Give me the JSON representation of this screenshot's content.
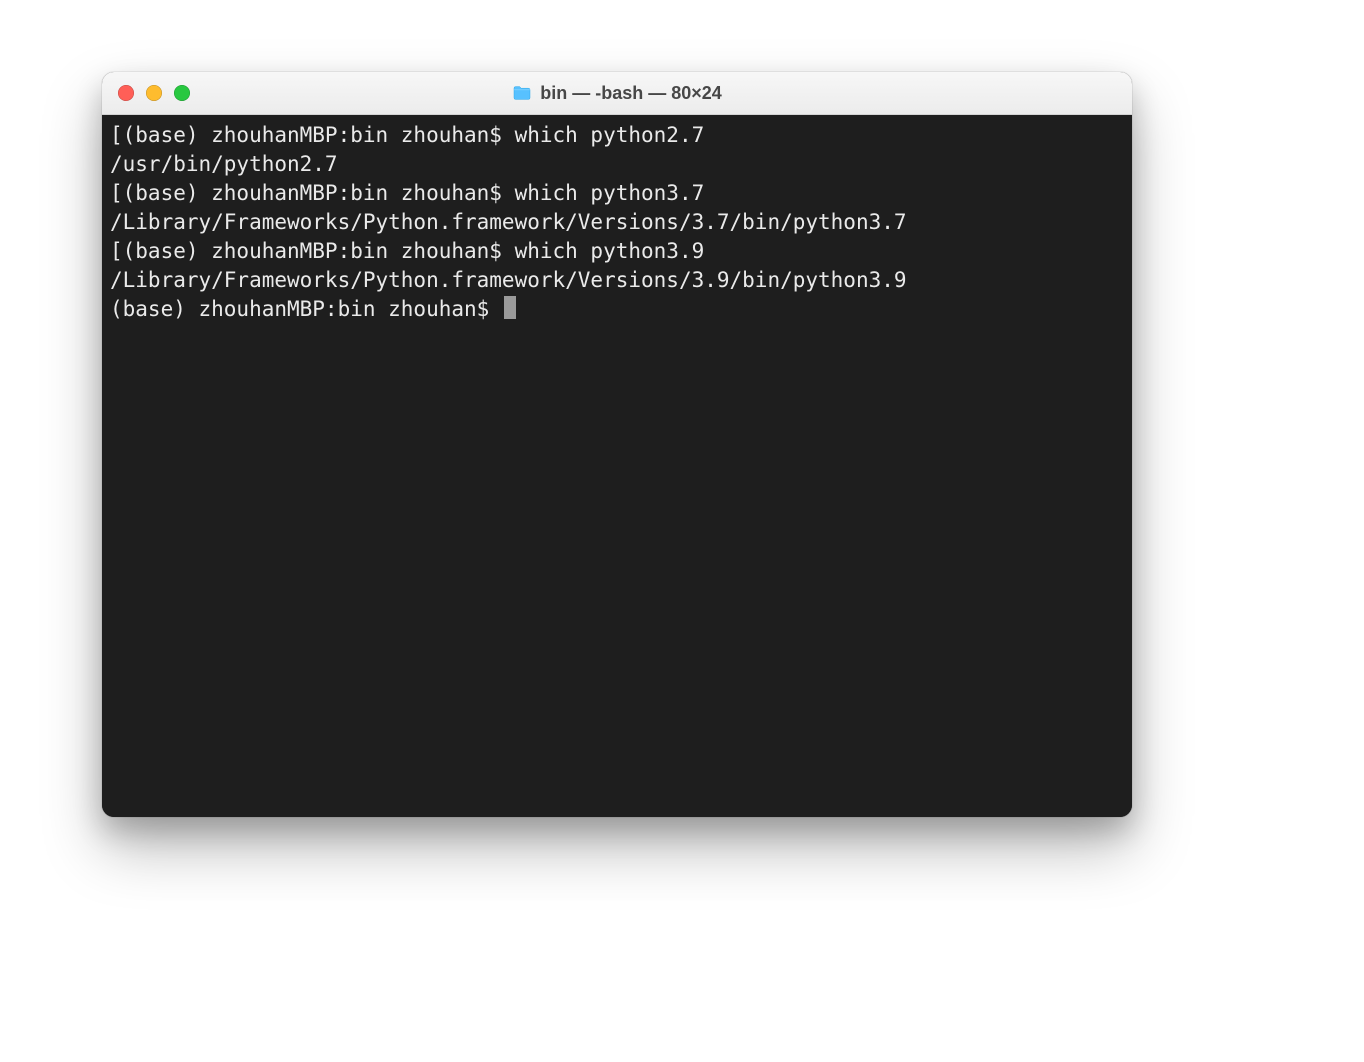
{
  "window": {
    "title": "bin — -bash — 80×24"
  },
  "terminal": {
    "lines": [
      "[(base) zhouhanMBP:bin zhouhan$ which python2.7",
      "/usr/bin/python2.7",
      "[(base) zhouhanMBP:bin zhouhan$ which python3.7",
      "/Library/Frameworks/Python.framework/Versions/3.7/bin/python3.7",
      "[(base) zhouhanMBP:bin zhouhan$ which python3.9",
      "/Library/Frameworks/Python.framework/Versions/3.9/bin/python3.9"
    ],
    "prompt": "(base) zhouhanMBP:bin zhouhan$ "
  },
  "icons": {
    "folder": "folder-icon",
    "close": "close-icon",
    "minimize": "minimize-icon",
    "zoom": "zoom-icon"
  }
}
